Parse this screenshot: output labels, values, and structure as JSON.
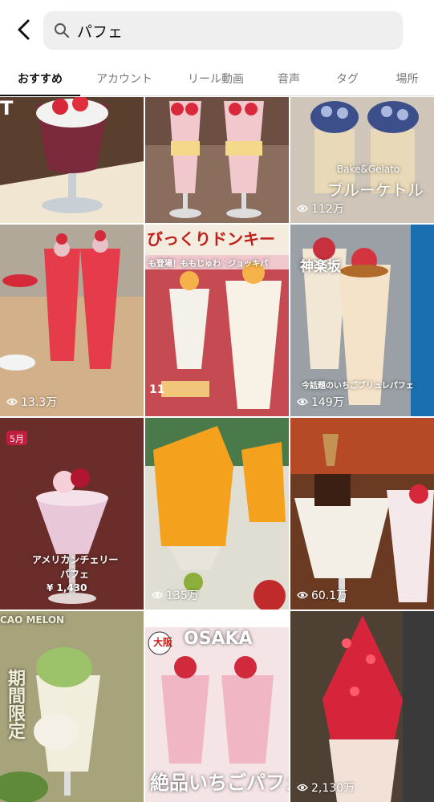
{
  "search": {
    "query": "パフェ"
  },
  "tabs": [
    {
      "label": "おすすめ",
      "active": true
    },
    {
      "label": "アカウント",
      "active": false
    },
    {
      "label": "リール動画",
      "active": false
    },
    {
      "label": "音声",
      "active": false
    },
    {
      "label": "タグ",
      "active": false
    },
    {
      "label": "場所",
      "active": false
    }
  ],
  "tiles": [
    {
      "views": "",
      "overlay": ""
    },
    {
      "views": "",
      "overlay": ""
    },
    {
      "views": "112万",
      "overlay": "ブルーケトル",
      "overlay2": "Bake&Gelato"
    },
    {
      "views": "13.3万",
      "overlay": ""
    },
    {
      "views": "",
      "overlay": "びっくりドンキー",
      "overlay2": "も登場！ももじゅわ♡ジョッキパ"
    },
    {
      "views": "149万",
      "overlay": "神楽坂",
      "overlay2": "今話題のいちごブリュレパフェ"
    },
    {
      "views": "",
      "overlay": "アメリカンチェリー",
      "overlay2": "パフェ",
      "overlay3": "¥ 1,430"
    },
    {
      "views": "135万",
      "overlay": ""
    },
    {
      "views": "60.1万",
      "overlay": ""
    },
    {
      "views": "",
      "overlay": "期間限定",
      "overlay2": "CAO MELON"
    },
    {
      "views": "",
      "overlay": "OSAKA",
      "overlay2": "絶品いちごパフェ",
      "overlay3": "大阪"
    },
    {
      "views": "2,130万",
      "overlay": ""
    }
  ],
  "colors": {
    "accent": "#111111",
    "tab_inactive": "#777777",
    "search_bg": "#efefef"
  }
}
